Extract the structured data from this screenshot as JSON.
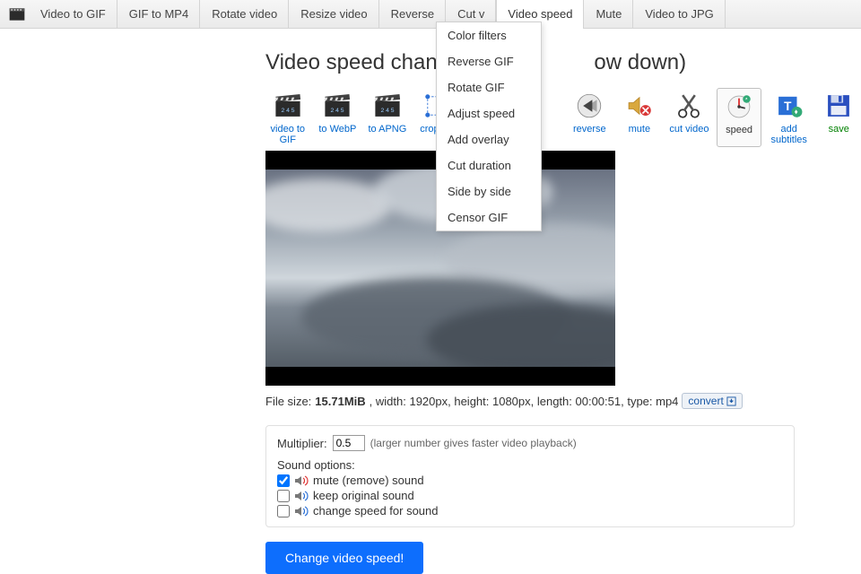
{
  "nav": {
    "items": [
      "Video to GIF",
      "GIF to MP4",
      "Rotate video",
      "Resize video",
      "Reverse",
      "Cut v",
      "Video speed",
      "Mute",
      "Video to JPG"
    ],
    "active_index": 6
  },
  "dropdown": {
    "items": [
      "Color filters",
      "Reverse GIF",
      "Rotate GIF",
      "Adjust speed",
      "Add overlay",
      "Cut duration",
      "Side by side",
      "Censor GIF"
    ]
  },
  "page_title": "Video speed changer                     ow down)",
  "tools": [
    {
      "label": "video to GIF",
      "kind": "clap"
    },
    {
      "label": "to WebP",
      "kind": "clap"
    },
    {
      "label": "to APNG",
      "kind": "clap"
    },
    {
      "label": "crop vid",
      "kind": "crop"
    },
    {
      "label": "reverse",
      "kind": "reverse"
    },
    {
      "label": "mute",
      "kind": "mute"
    },
    {
      "label": "cut video",
      "kind": "cut"
    },
    {
      "label": "speed",
      "kind": "speed",
      "active": true
    },
    {
      "label": "add subtitles",
      "kind": "subs"
    },
    {
      "label": "save",
      "kind": "save",
      "green": true
    }
  ],
  "info": {
    "prefix": "File size: ",
    "size": "15.71MiB",
    "rest": ", width: 1920px, height: 1080px, length: 00:00:51, type: mp4",
    "convert": "convert"
  },
  "panel": {
    "multiplier_label": "Multiplier:",
    "multiplier_value": "0.5",
    "hint": "(larger number gives faster video playback)",
    "sound_header": "Sound options:",
    "opts": [
      {
        "label": "mute (remove) sound",
        "checked": true,
        "color": "red"
      },
      {
        "label": "keep original sound",
        "checked": false,
        "color": "blue"
      },
      {
        "label": "change speed for sound",
        "checked": false,
        "color": "blue"
      }
    ]
  },
  "primary": "Change video speed!"
}
